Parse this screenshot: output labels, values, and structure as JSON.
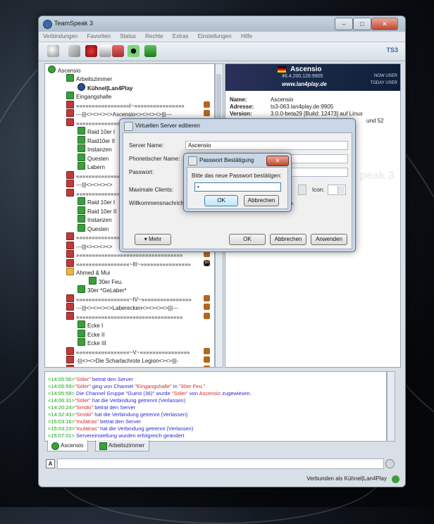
{
  "window": {
    "title": "TeamSpeak 3",
    "min_glyph": "–",
    "max_glyph": "□",
    "close_glyph": "✕"
  },
  "menu": [
    "Verbindungen",
    "Favoriten",
    "Status",
    "Rechte",
    "Extras",
    "Einstellungen",
    "Hilfe"
  ],
  "toolbar": {
    "icons": [
      "connect-icon",
      "bookmark-icon",
      "disconnect-icon",
      "away-icon",
      "microphone-icon",
      "speaker-icon",
      "whisper-icon"
    ],
    "logo": "TS3"
  },
  "tree": {
    "server": "Ascensio",
    "channels": [
      {
        "label": "Arbeitszimmer",
        "kind": "chan",
        "level": 1
      },
      {
        "label": "Kühnel|Lan4Play",
        "kind": "user",
        "level": 2
      },
      {
        "label": "Eingangshalle",
        "kind": "chan",
        "level": 1
      },
      {
        "label": "«««««««««««««««««I~»»»»»»»»»»»»»»»»",
        "kind": "chan-red",
        "level": 1
      },
      {
        "label": "---|||<><><><>Ascensio<><><><>|||---",
        "kind": "chan-red",
        "level": 1
      },
      {
        "label": "»»»»»»»»»»»»»»»»»»»»»»»»»»»»»»»»»»",
        "kind": "chan-red",
        "level": 1
      },
      {
        "label": "Raid 10er I",
        "kind": "chan",
        "level": 2
      },
      {
        "label": "Raid10er II",
        "kind": "chan",
        "level": 2
      },
      {
        "label": "Instanzen",
        "kind": "chan",
        "level": 2
      },
      {
        "label": "Questen",
        "kind": "chan",
        "level": 2
      },
      {
        "label": "Labern",
        "kind": "chan",
        "level": 2
      },
      {
        "label": "«««««««««««««««««II~»»»»»»»»»»»»»»»",
        "kind": "chan-red",
        "level": 1
      },
      {
        "label": "---|||<><><><>",
        "kind": "chan-red",
        "level": 1
      },
      {
        "label": "»»»»»»»»»»»»»»»»»»»»»»»»»»»»»»»»»»",
        "kind": "chan-red",
        "level": 1
      },
      {
        "label": "Raid 10er I",
        "kind": "chan",
        "level": 2
      },
      {
        "label": "Raid 10er II",
        "kind": "chan",
        "level": 2
      },
      {
        "label": "Instanzen",
        "kind": "chan",
        "level": 2
      },
      {
        "label": "Questen",
        "kind": "chan",
        "level": 2
      },
      {
        "label": "«««««««««««««««««««««««««««««««««««",
        "kind": "chan-red",
        "level": 1
      },
      {
        "label": "---|||<><><><>",
        "kind": "chan-red",
        "level": 1
      },
      {
        "label": "»»»»»»»»»»»»»»»»»»»»»»»»»»»»»»»»»»",
        "kind": "chan-red",
        "level": 1
      },
      {
        "label": "«««««««««««««««««~III~»»»»»»»»»»»»»»»»",
        "kind": "chan-red",
        "level": 1
      },
      {
        "label": "Ahmed & Mui",
        "kind": "folder",
        "level": 1
      },
      {
        "label": "30er Feu.",
        "kind": "chan",
        "level": 3
      },
      {
        "label": "30er *GeLaber*",
        "kind": "chan",
        "level": 2
      },
      {
        "label": "«««««««««««««««««~IV~»»»»»»»»»»»»»»»»",
        "kind": "chan-red",
        "level": 1
      },
      {
        "label": "---|||<><><><>Laberecken<><><><>|||---",
        "kind": "chan-red",
        "level": 1
      },
      {
        "label": "»»»»»»»»»»»»»»»»»»»»»»»»»»»»»»»»»»",
        "kind": "chan-red",
        "level": 1
      },
      {
        "label": "Ecke I",
        "kind": "chan",
        "level": 2
      },
      {
        "label": "Ecke II",
        "kind": "chan",
        "level": 2
      },
      {
        "label": "Ecke III",
        "kind": "chan",
        "level": 2
      },
      {
        "label": "«««««««««««««««««~V~»»»»»»»»»»»»»»»»",
        "kind": "chan-red",
        "level": 1
      },
      {
        "label": "-|||<><>Die Scharlachrote Legion<><>|||-",
        "kind": "chan-red",
        "level": 1
      },
      {
        "label": "»»»»»»»»»»»»»»»»»»»»»»»»»»»»»»»»»»",
        "kind": "chan-red",
        "level": 1
      }
    ],
    "badge_30": "30"
  },
  "info": {
    "banner_name": "Ascensio",
    "banner_ip": "46.4.200.126:9905",
    "banner_url": "www.lan4play.de",
    "now_user": "NOW USER",
    "today_user": "TODAY USER",
    "fields": [
      {
        "key": "Name:",
        "value": "Ascensio"
      },
      {
        "key": "Adresse:",
        "value": "ts3-063.lan4play.de:9905"
      },
      {
        "key": "Version:",
        "value": "3.0.0-beta29 [Build: 12473] auf Linux"
      }
    ],
    "extra_suffix": "und 52",
    "watermark": "peak 3"
  },
  "vs_dialog": {
    "title": "Virtuellen Server editieren",
    "fields": [
      {
        "label": "Server Name:",
        "value": "Ascensio"
      },
      {
        "label": "Phonetischer Name:",
        "value": ""
      },
      {
        "label": "Passwort:",
        "value": ""
      }
    ],
    "max_clients_label": "Maximale Clients:",
    "icon_label": "Icon:",
    "welcome_label": "Willkommensnachricht:",
    "welcome_suffix": "sio.",
    "more_button": "Mehr",
    "ok_button": "OK",
    "cancel_button": "Abbrechen",
    "apply_button": "Anwenden"
  },
  "pw_dialog": {
    "title": "Passwort Bestätigung",
    "prompt": "Bitte das neue Passwort bestätigen:",
    "value": "•",
    "ok_button": "OK",
    "cancel_button": "Abbrechen"
  },
  "chat": {
    "lines": [
      {
        "time": "<14:05:56>",
        "parts": [
          [
            "rd",
            "\"Söler\""
          ],
          [
            "bl",
            " betrat den Server"
          ]
        ]
      },
      {
        "time": "<14:05:59>",
        "parts": [
          [
            "rd",
            "\"Söler\""
          ],
          [
            "bl",
            " ging von Channel "
          ],
          [
            "rd",
            "\"Eingangshalle\""
          ],
          [
            "bl",
            " in "
          ],
          [
            "rd",
            "\"30er Feu.\""
          ]
        ]
      },
      {
        "time": "<14:05:59>",
        "parts": [
          [
            "bl",
            " Die Channel Gruppe \"Guest (36)\" wurde "
          ],
          [
            "rd",
            "\"Söler\""
          ],
          [
            "bl",
            " von "
          ],
          [
            "rd",
            "Ascensio"
          ],
          [
            "bl",
            " zugewiesen."
          ]
        ]
      },
      {
        "time": "<14:06:31>",
        "parts": [
          [
            "rd",
            "\"Söler\""
          ],
          [
            "bl",
            " hat die Verbindung getrennt (Verlassen)"
          ]
        ]
      },
      {
        "time": "<14:20:24>",
        "parts": [
          [
            "rd",
            "\"Smöki\""
          ],
          [
            "bl",
            " betrat den Server"
          ]
        ]
      },
      {
        "time": "<14:32:43>",
        "parts": [
          [
            "rd",
            "\"Smöki\""
          ],
          [
            "bl",
            " hat die Verbindung getrennt (Verlassen)"
          ]
        ]
      },
      {
        "time": "<15:03:16>",
        "parts": [
          [
            "rd",
            "\"mulätras\""
          ],
          [
            "bl",
            " betrat den Server"
          ]
        ]
      },
      {
        "time": "<15:03:23>",
        "parts": [
          [
            "rd",
            "\"mulätras\""
          ],
          [
            "bl",
            " hat die Verbindung getrennt (Verlassen)"
          ]
        ]
      },
      {
        "time": "<15:07:01>",
        "parts": [
          [
            "bl",
            " Servereinstellung wurden erfolgreich geändert"
          ]
        ]
      }
    ]
  },
  "tabs": [
    "Ascensio",
    "Arbeitszimmer"
  ],
  "status": "Verbunden als Kühnel|Lan4Play"
}
